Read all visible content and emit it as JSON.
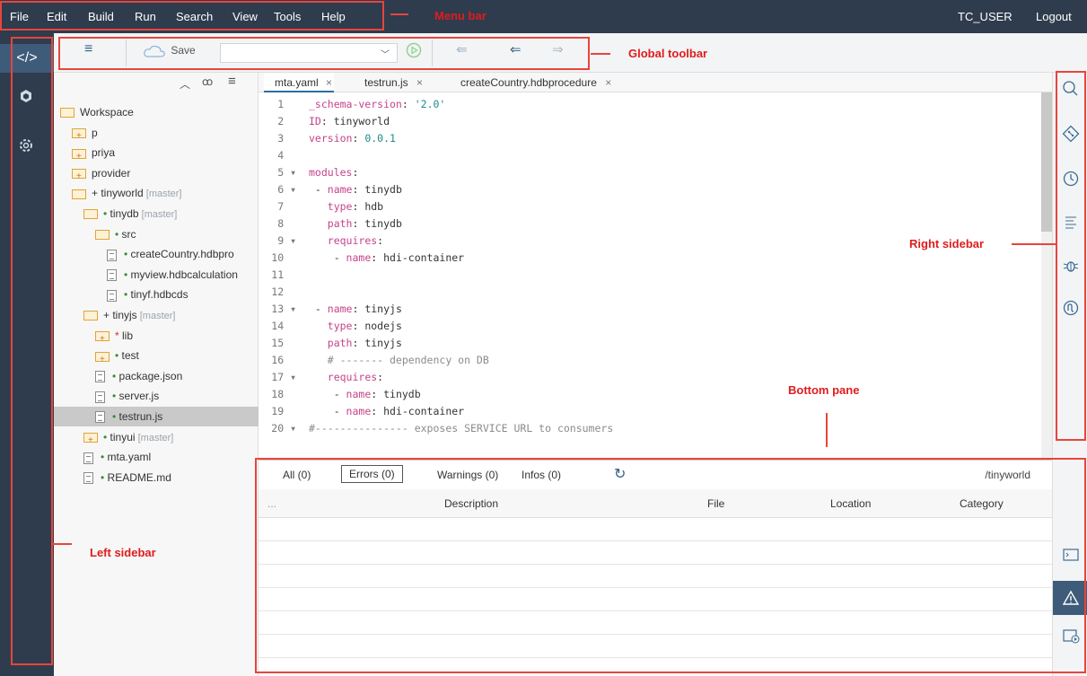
{
  "menu": {
    "items": [
      "File",
      "Edit",
      "Build",
      "Run",
      "Search",
      "View",
      "Tools",
      "Help"
    ],
    "user": "TC_USER",
    "logout": "Logout"
  },
  "left_sidebar": {
    "icons": [
      "code-icon",
      "package-icon",
      "gear-icon"
    ]
  },
  "toolbar": {
    "menu_icon": "hamburger-icon",
    "save_label": "Save",
    "combo_value": "",
    "run_icon": "play-icon",
    "nav_icons": [
      "back-alt-icon",
      "back-icon",
      "forward-icon"
    ]
  },
  "tree": {
    "header_icons": [
      "collapse-icon",
      "binoculars-icon",
      "menu-icon"
    ],
    "rows": [
      {
        "indent": 0,
        "kind": "folder-open",
        "prefix": "",
        "name": "Workspace",
        "branch": ""
      },
      {
        "indent": 1,
        "kind": "folder-plus",
        "prefix": "",
        "name": "p",
        "branch": ""
      },
      {
        "indent": 1,
        "kind": "folder-plus",
        "prefix": "",
        "name": "priya",
        "branch": ""
      },
      {
        "indent": 1,
        "kind": "folder-plus",
        "prefix": "",
        "name": "provider",
        "branch": ""
      },
      {
        "indent": 1,
        "kind": "folder-open",
        "prefix": "+ ",
        "name": "tinyworld",
        "branch": "[master]"
      },
      {
        "indent": 2,
        "kind": "folder-open",
        "prefix": "• ",
        "name": "tinydb",
        "branch": "[master]"
      },
      {
        "indent": 3,
        "kind": "folder-open",
        "prefix": "• ",
        "name": "src",
        "branch": ""
      },
      {
        "indent": 4,
        "kind": "file",
        "prefix": "• ",
        "name": "createCountry.hdbpro",
        "branch": ""
      },
      {
        "indent": 4,
        "kind": "file",
        "prefix": "• ",
        "name": "myview.hdbcalculation",
        "branch": ""
      },
      {
        "indent": 4,
        "kind": "file",
        "prefix": "• ",
        "name": "tinyf.hdbcds",
        "branch": ""
      },
      {
        "indent": 2,
        "kind": "folder-open",
        "prefix": "+ ",
        "name": "tinyjs",
        "branch": "[master]"
      },
      {
        "indent": 3,
        "kind": "folder-plus",
        "prefix": "* ",
        "name": "lib",
        "branch": ""
      },
      {
        "indent": 3,
        "kind": "folder-plus",
        "prefix": "• ",
        "name": "test",
        "branch": ""
      },
      {
        "indent": 3,
        "kind": "file",
        "prefix": "• ",
        "name": "package.json",
        "branch": ""
      },
      {
        "indent": 3,
        "kind": "file",
        "prefix": "• ",
        "name": "server.js",
        "branch": ""
      },
      {
        "indent": 3,
        "kind": "file",
        "prefix": "• ",
        "name": "testrun.js",
        "branch": "",
        "selected": true
      },
      {
        "indent": 2,
        "kind": "folder-plus",
        "prefix": "• ",
        "name": "tinyui",
        "branch": "[master]"
      },
      {
        "indent": 2,
        "kind": "file",
        "prefix": "• ",
        "name": "mta.yaml",
        "branch": ""
      },
      {
        "indent": 2,
        "kind": "file",
        "prefix": "• ",
        "name": "README.md",
        "branch": ""
      }
    ]
  },
  "tabs": [
    {
      "label": "mta.yaml",
      "close": "×",
      "active": true
    },
    {
      "label": "testrun.js",
      "close": "×",
      "active": false
    },
    {
      "label": "createCountry.hdbprocedure",
      "close": "×",
      "active": false
    }
  ],
  "editor": {
    "lines": [
      {
        "n": "1",
        "fold": "",
        "tokens": [
          [
            "k",
            "_schema-version"
          ],
          [
            "",
            ": "
          ],
          [
            "v",
            "'2.0'"
          ]
        ]
      },
      {
        "n": "2",
        "fold": "",
        "tokens": [
          [
            "k",
            "ID"
          ],
          [
            "",
            ": tinyworld"
          ]
        ]
      },
      {
        "n": "3",
        "fold": "",
        "tokens": [
          [
            "k",
            "version"
          ],
          [
            "",
            ": "
          ],
          [
            "v",
            "0.0.1"
          ]
        ]
      },
      {
        "n": "4",
        "fold": "",
        "tokens": []
      },
      {
        "n": "5",
        "fold": "▾",
        "tokens": [
          [
            "k",
            "modules"
          ],
          [
            "",
            ":"
          ]
        ]
      },
      {
        "n": "6",
        "fold": "▾",
        "tokens": [
          [
            "",
            " - "
          ],
          [
            "k",
            "name"
          ],
          [
            "",
            ": tinydb"
          ]
        ]
      },
      {
        "n": "7",
        "fold": "",
        "tokens": [
          [
            "",
            "   "
          ],
          [
            "k",
            "type"
          ],
          [
            "",
            ": hdb"
          ]
        ]
      },
      {
        "n": "8",
        "fold": "",
        "tokens": [
          [
            "",
            "   "
          ],
          [
            "k",
            "path"
          ],
          [
            "",
            ": tinydb"
          ]
        ]
      },
      {
        "n": "9",
        "fold": "▾",
        "tokens": [
          [
            "",
            "   "
          ],
          [
            "k",
            "requires"
          ],
          [
            "",
            ":"
          ]
        ]
      },
      {
        "n": "10",
        "fold": "",
        "tokens": [
          [
            "",
            "    - "
          ],
          [
            "k",
            "name"
          ],
          [
            "",
            ": hdi-container"
          ]
        ]
      },
      {
        "n": "11",
        "fold": "",
        "tokens": []
      },
      {
        "n": "12",
        "fold": "",
        "tokens": []
      },
      {
        "n": "13",
        "fold": "▾",
        "tokens": [
          [
            "",
            " - "
          ],
          [
            "k",
            "name"
          ],
          [
            "",
            ": tinyjs"
          ]
        ]
      },
      {
        "n": "14",
        "fold": "",
        "tokens": [
          [
            "",
            "   "
          ],
          [
            "k",
            "type"
          ],
          [
            "",
            ": nodejs"
          ]
        ]
      },
      {
        "n": "15",
        "fold": "",
        "tokens": [
          [
            "",
            "   "
          ],
          [
            "k",
            "path"
          ],
          [
            "",
            ": tinyjs"
          ]
        ]
      },
      {
        "n": "16",
        "fold": "",
        "tokens": [
          [
            "c",
            "   # ------- dependency on DB"
          ]
        ]
      },
      {
        "n": "17",
        "fold": "▾",
        "tokens": [
          [
            "",
            "   "
          ],
          [
            "k",
            "requires"
          ],
          [
            "",
            ":"
          ]
        ]
      },
      {
        "n": "18",
        "fold": "",
        "tokens": [
          [
            "",
            "    - "
          ],
          [
            "k",
            "name"
          ],
          [
            "",
            ": tinydb"
          ]
        ]
      },
      {
        "n": "19",
        "fold": "",
        "tokens": [
          [
            "",
            "    - "
          ],
          [
            "k",
            "name"
          ],
          [
            "",
            ": hdi-container"
          ]
        ]
      },
      {
        "n": "20",
        "fold": "▾",
        "tokens": [
          [
            "c",
            "#--------------- exposes SERVICE URL to consumers"
          ]
        ]
      }
    ]
  },
  "right_sidebar": {
    "icons": [
      "search-icon",
      "git-icon",
      "history-icon",
      "outline-icon",
      "debug-icon",
      "api-icon"
    ],
    "bottom_icons": [
      "console-icon",
      "warning-icon",
      "run-console-icon"
    ]
  },
  "bottom": {
    "tabs": [
      {
        "label": "All (0)",
        "active": false
      },
      {
        "label": "Errors (0)",
        "active": true
      },
      {
        "label": "Warnings (0)",
        "active": false
      },
      {
        "label": "Infos (0)",
        "active": false
      }
    ],
    "refresh_icon": "refresh-icon",
    "path": "/tinyworld",
    "columns": [
      "...",
      "Description",
      "File",
      "Location",
      "Category"
    ]
  },
  "annotations": {
    "menu_bar": "Menu bar",
    "global_toolbar": "Global toolbar",
    "right_sidebar": "Right sidebar",
    "bottom_pane": "Bottom pane",
    "left_sidebar": "Left sidebar",
    "color": "#e8453c"
  }
}
